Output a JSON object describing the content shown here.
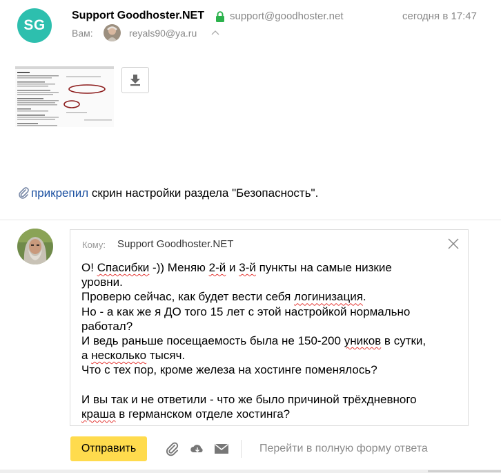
{
  "message": {
    "sender_initials": "SG",
    "sender_name": "Support Goodhoster.NET",
    "sender_email": "support@goodhoster.net",
    "timestamp": "сегодня в 17:47",
    "to_label": "Вам:",
    "recipient_email": "reyals90@ya.ru",
    "body_link": "прикрепил",
    "body_text": " скрин настройки раздела \"Безопасность\"."
  },
  "reply": {
    "to_label": "Кому:",
    "to_value": "Support Goodhoster.NET",
    "text_lines": [
      "О! Спасибки -)) Меняю 2-й и 3-й пункты на самые низкие",
      "уровни.",
      "Проверю сейчас, как будет вести себя логинизация.",
      "Но - а как же я ДО того 15 лет с этой настройкой нормально",
      "работал?",
      "И ведь раньше посещаемость была не 150-200 уников в сутки,",
      "а несколько тысяч.",
      "Что с тех пор, кроме железа на хостинге поменялось?",
      "",
      "И вы так и не ответили - что же было причиной трёхдневного",
      "краша в германском отделе хостинга?"
    ]
  },
  "toolbar": {
    "send_label": "Отправить",
    "full_form_label": "Перейти в полную форму ответа"
  },
  "icons": {
    "lock": "lock-icon",
    "chevron": "chevron-up-icon",
    "download": "download-icon",
    "paperclip": "paperclip-icon",
    "close": "close-icon",
    "attach": "paperclip-icon",
    "cloud": "cloud-icon",
    "mail": "envelope-icon"
  },
  "colors": {
    "avatar_bg": "#2dbfae",
    "send_button": "#ffdb4d",
    "link": "#1a4fa0",
    "lock": "#2bb24c"
  }
}
